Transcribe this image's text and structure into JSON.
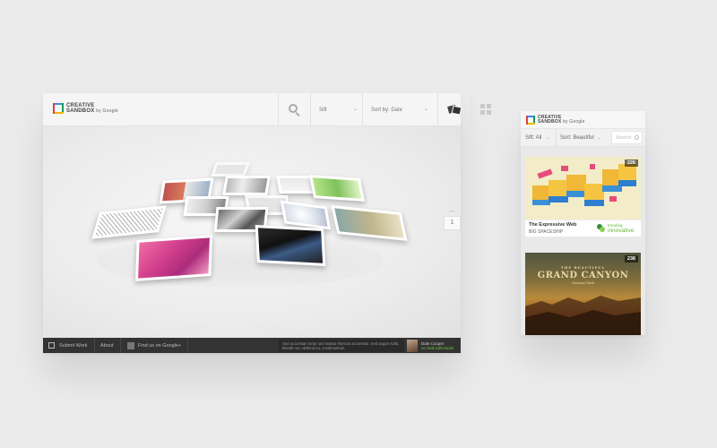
{
  "desktop": {
    "logo": {
      "line1": "CREATIVE",
      "line2": "SANDBOX",
      "by": "by Google"
    },
    "sift": {
      "label": "Sift"
    },
    "sort": {
      "label": "Sort by: Date"
    },
    "pager": {
      "page": "1"
    },
    "footer": {
      "submit": "Submit Work",
      "about": "About",
      "google_plus": "Find us on Google+",
      "description": "Sed accumsan tortor sed massa rhoncus accumsan. Sed augue nulla, blandit nec eleifend eu, condimentum.",
      "user_name": "Dale Cooper",
      "user_sub": "on Sed sollicitudin"
    }
  },
  "mobile": {
    "logo": {
      "line1": "CREATIVE",
      "line2": "SANDBOX",
      "by": "by Google"
    },
    "sift": {
      "label": "Sift: All"
    },
    "sort": {
      "label": "Sort: Beautiful"
    },
    "search": {
      "placeholder": "Search"
    },
    "cards": [
      {
        "count": "226",
        "title": "The Expressive Web",
        "author": "BIG SPACESHIP",
        "trend_small": "trending",
        "trend_big": "innovative"
      },
      {
        "count": "238",
        "headline_small": "THE BEAUTIFUL",
        "headline": "GRAND CANYON",
        "headline_sub": "National Park"
      }
    ]
  },
  "colors": {
    "logo_blue": "#4285f4",
    "logo_red": "#db4437",
    "logo_yellow": "#f4b400",
    "logo_green": "#0f9d58",
    "trend_green": "#6db33f",
    "footer_bg": "#333333"
  }
}
